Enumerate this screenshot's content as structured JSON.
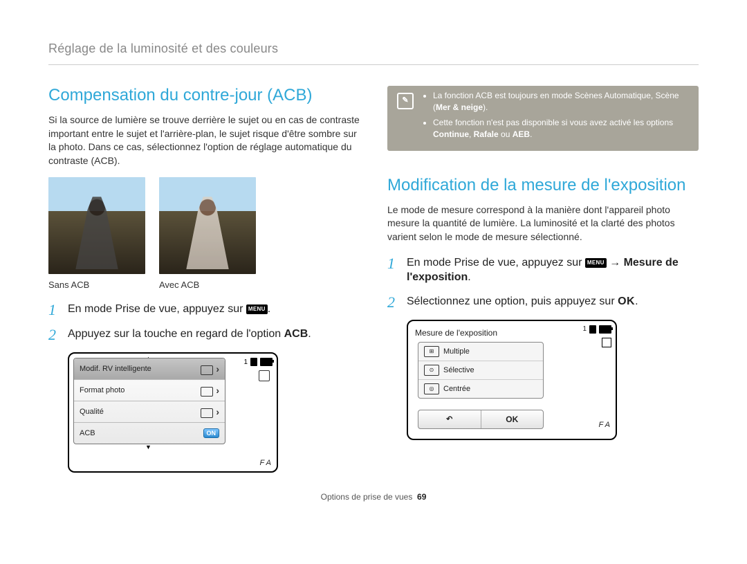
{
  "header": "Réglage de la luminosité et des couleurs",
  "left": {
    "title": "Compensation du contre-jour (ACB)",
    "desc": "Si la source de lumière se trouve derrière le sujet ou en cas de contraste important entre le sujet et l'arrière-plan, le sujet risque d'être sombre sur la photo. Dans ce cas, sélectionnez l'option de réglage automatique du contraste (ACB).",
    "caption_without": "Sans ACB",
    "caption_with": "Avec ACB",
    "step1": "En mode Prise de vue, appuyez sur ",
    "step1_end": ".",
    "menu_label": "MENU",
    "step2_a": "Appuyez sur la touche en regard de l'option ",
    "step2_b": "ACB",
    "step2_c": ".",
    "screen": {
      "row1": "Modif. RV intelligente",
      "row2": "Format photo",
      "row3": "Qualité",
      "row4": "ACB",
      "on": "ON",
      "status_num": "1",
      "fa": "F A"
    }
  },
  "right": {
    "note": {
      "line1a": "La fonction ACB est toujours en mode Scènes Automatique, Scène (",
      "line1b": "Mer & neige",
      "line1c": ").",
      "line2a": "Cette fonction n'est pas disponible si vous avez activé les options ",
      "line2b": "Continue",
      "line2c": ", ",
      "line2d": "Rafale",
      "line2e": " ou ",
      "line2f": "AEB",
      "line2g": "."
    },
    "title": "Modification de la mesure de l'exposition",
    "desc": "Le mode de mesure correspond à la manière dont l'appareil photo mesure la quantité de lumière. La luminosité et la clarté des photos varient selon le mode de mesure sélectionné.",
    "step1a": "En mode Prise de vue, appuyez sur ",
    "step1b": " → ",
    "step1c": "Mesure de l'exposition",
    "step1d": ".",
    "menu_label": "MENU",
    "step2a": "Sélectionnez une option, puis appuyez sur ",
    "step2b": "OK",
    "step2c": ".",
    "screen": {
      "title": "Mesure de l'exposition",
      "opt1": "Multiple",
      "opt2": "Sélective",
      "opt3": "Centrée",
      "back": "↶",
      "ok": "OK",
      "status_num": "1",
      "fa": "F A"
    }
  },
  "footer": {
    "section": "Options de prise de vues",
    "page": "69"
  }
}
